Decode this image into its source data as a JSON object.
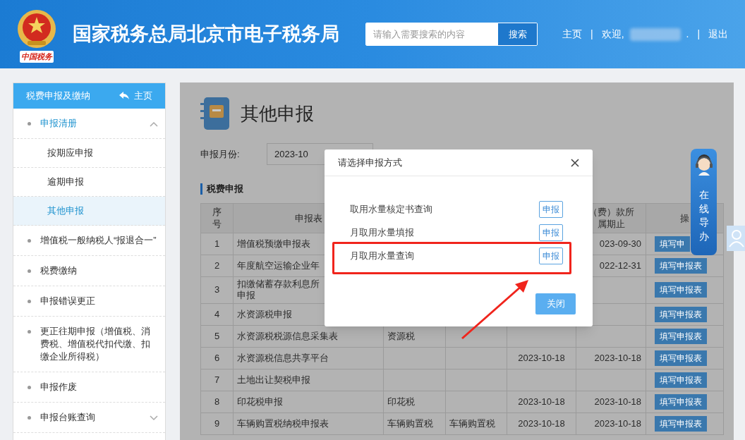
{
  "header": {
    "logo_caption": "中国税务",
    "title": "国家税务总局北京市电子税务局",
    "search": {
      "placeholder": "请输入需要搜索的内容",
      "button": "搜索"
    },
    "nav": [
      {
        "kind": "link",
        "label": "主页"
      },
      {
        "kind": "divider",
        "label": "|"
      },
      {
        "kind": "text",
        "label": "欢迎,"
      },
      {
        "kind": "redacted"
      },
      {
        "kind": "text",
        "label": "."
      },
      {
        "kind": "divider",
        "label": "|"
      },
      {
        "kind": "link",
        "label": "退出"
      }
    ]
  },
  "sidebar": {
    "title": "税费申报及缴纳",
    "home_link": "主页",
    "items": [
      {
        "label": "申报清册",
        "selected": true,
        "expanded": true,
        "children": [
          {
            "label": "按期应申报",
            "selected": false
          },
          {
            "label": "逾期申报",
            "selected": false
          },
          {
            "label": "其他申报",
            "selected": true
          }
        ]
      },
      {
        "label": "增值税一般纳税人“报退合一”",
        "selected": false
      },
      {
        "label": "税费缴纳",
        "selected": false
      },
      {
        "label": "申报错误更正",
        "selected": false
      },
      {
        "label": "更正往期申报（增值税、消费税、增值税代扣代缴、扣缴企业所得税）",
        "selected": false
      },
      {
        "label": "申报作废",
        "selected": false
      },
      {
        "label": "申报台账查询",
        "selected": false,
        "expanded": false
      }
    ]
  },
  "main": {
    "title": "其他申报",
    "month_label": "申报月份:",
    "month_value": "2023-10",
    "section": "税费申报",
    "table": {
      "columns": [
        "序号",
        "申报表",
        null,
        null,
        null,
        "（费）款所属期止",
        "操"
      ],
      "rows": [
        {
          "cells": [
            "1",
            "增值税预缴申报表",
            null,
            null,
            null,
            "023-09-30"
          ],
          "action": "填写申"
        },
        {
          "cells": [
            "2",
            "年度航空运输企业年",
            null,
            null,
            null,
            "022-12-31"
          ],
          "action": "填写申报表"
        },
        {
          "cells": [
            "3",
            [
              "扣缴储蓄存款利息所",
              "申报"
            ],
            null,
            null,
            null,
            null
          ],
          "action": "填写申报表"
        },
        {
          "cells": [
            "4",
            "水资源税申报",
            null,
            null,
            null,
            null
          ],
          "action": "填写申报表"
        },
        {
          "cells": [
            "5",
            "水资源税税源信息采集表",
            "资源税",
            null,
            null,
            null
          ],
          "action": "填写申报表"
        },
        {
          "cells": [
            "6",
            "水资源税信息共享平台",
            null,
            null,
            "2023-10-18",
            "2023-10-18"
          ],
          "action": "填写申报表"
        },
        {
          "cells": [
            "7",
            "土地出让契税申报",
            null,
            null,
            null,
            null
          ],
          "action": "填写申报表"
        },
        {
          "cells": [
            "8",
            "印花税申报",
            "印花税",
            null,
            "2023-10-18",
            "2023-10-18"
          ],
          "action": "填写申报表"
        },
        {
          "cells": [
            "9",
            "车辆购置税纳税申报表",
            "车辆购置税",
            "车辆购置税",
            "2023-10-18",
            "2023-10-18"
          ],
          "action": "填写申报表"
        }
      ]
    }
  },
  "guide_widget": {
    "label": "在线导办"
  },
  "dialog": {
    "title": "请选择申报方式",
    "options": [
      {
        "label": "取用水量核定书查询",
        "button": "申报",
        "highlighted": false
      },
      {
        "label": "月取用水量填报",
        "button": "申报",
        "highlighted": false
      },
      {
        "label": "月取用水量查询",
        "button": "申报",
        "highlighted": true
      }
    ],
    "close_button": "关闭"
  }
}
